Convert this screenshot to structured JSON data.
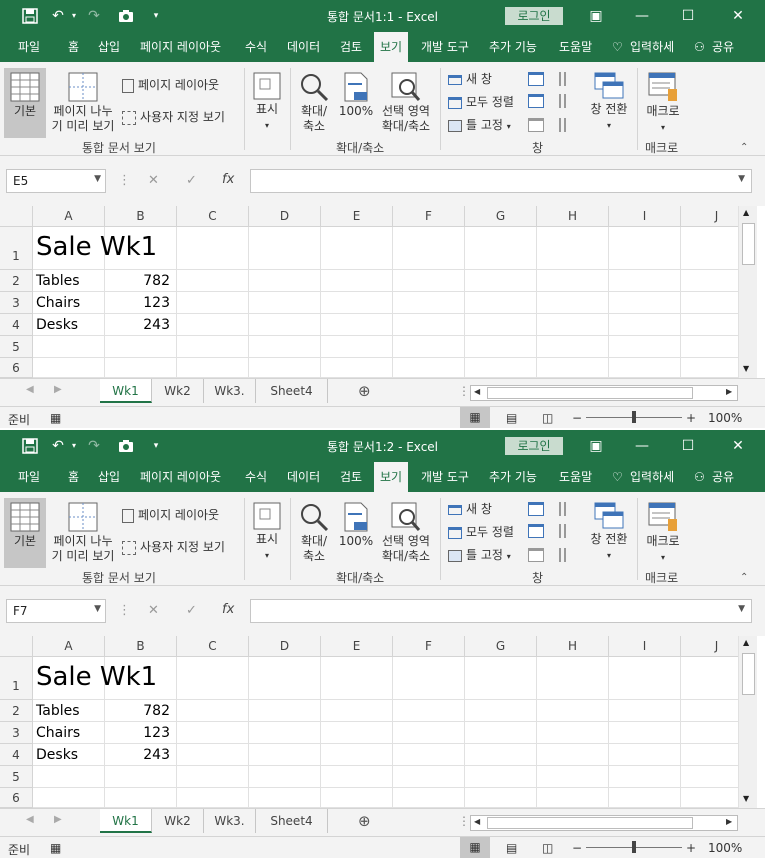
{
  "windows": [
    {
      "title": "통합 문서1:1 - Excel",
      "name_box": "E5",
      "sheets": [
        {
          "label": "Wk1",
          "active": true
        },
        {
          "label": "Wk2",
          "active": false
        },
        {
          "label": "Wk3.",
          "active": false
        },
        {
          "label": "Sheet4",
          "active": false
        }
      ]
    },
    {
      "title": "통합 문서1:2 - Excel",
      "name_box": "F7",
      "sheets": [
        {
          "label": "Wk1",
          "active": true
        },
        {
          "label": "Wk2",
          "active": false
        },
        {
          "label": "Wk3.",
          "active": false
        },
        {
          "label": "Sheet4",
          "active": false
        }
      ]
    }
  ],
  "login_label": "로그인",
  "tabs": [
    "파일",
    "홈",
    "삽입",
    "페이지 레이아웃",
    "수식",
    "데이터",
    "검토",
    "보기",
    "개발 도구",
    "추가 기능",
    "도움말"
  ],
  "active_tab": "보기",
  "tell_me": "입력하세",
  "share": "공유",
  "ribbon": {
    "normal": "기본",
    "page_break": [
      "페이지 나누",
      "기 미리 보기"
    ],
    "page_layout": "페이지 레이아웃",
    "custom_views": "사용자 지정 보기",
    "group_workbook_views": "통합 문서 보기",
    "show": "표시",
    "zoom": [
      "확대/",
      "축소"
    ],
    "zoom_100": "100%",
    "zoom_selection": [
      "선택 영역",
      "확대/축소"
    ],
    "group_zoom": "확대/축소",
    "new_window": "새 창",
    "arrange_all": "모두 정렬",
    "freeze_panes": "틀 고정",
    "switch_windows": "창 전환",
    "group_window": "창",
    "macros": "매크로",
    "group_macros": "매크로"
  },
  "columns": [
    "A",
    "B",
    "C",
    "D",
    "E",
    "F",
    "G",
    "H",
    "I",
    "J"
  ],
  "rows": [
    "1",
    "2",
    "3",
    "4",
    "5",
    "6"
  ],
  "cells": {
    "title": "Sale Wk1",
    "items": [
      {
        "name": "Tables",
        "value": "782"
      },
      {
        "name": "Chairs",
        "value": "123"
      },
      {
        "name": "Desks",
        "value": "243"
      }
    ]
  },
  "status": {
    "ready": "준비",
    "zoom": "100%"
  },
  "colors": {
    "excel_green": "#217346",
    "ribbon_bg": "#f3f3f3"
  }
}
